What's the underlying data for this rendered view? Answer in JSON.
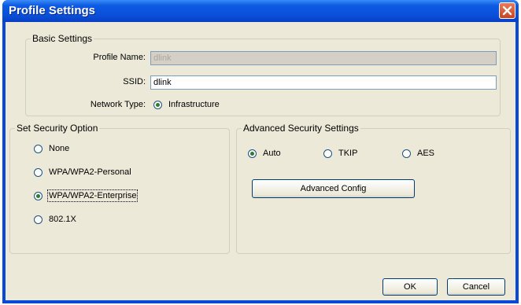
{
  "window": {
    "title": "Profile Settings"
  },
  "basic_settings": {
    "legend": "Basic Settings",
    "profile_name_label": "Profile Name:",
    "profile_name_value": "dlink",
    "ssid_label": "SSID:",
    "ssid_value": "dlink",
    "network_type_label": "Network Type:",
    "network_type_option": "Infrastructure"
  },
  "security_option": {
    "legend": "Set Security Option",
    "options": [
      "None",
      "WPA/WPA2-Personal",
      "WPA/WPA2-Enterprise",
      "802.1X"
    ],
    "selected": "WPA/WPA2-Enterprise"
  },
  "advanced_security": {
    "legend": "Advanced Security Settings",
    "options": [
      "Auto",
      "TKIP",
      "AES"
    ],
    "selected": "Auto",
    "config_button": "Advanced Config"
  },
  "footer": {
    "ok_label": "OK",
    "cancel_label": "Cancel"
  }
}
